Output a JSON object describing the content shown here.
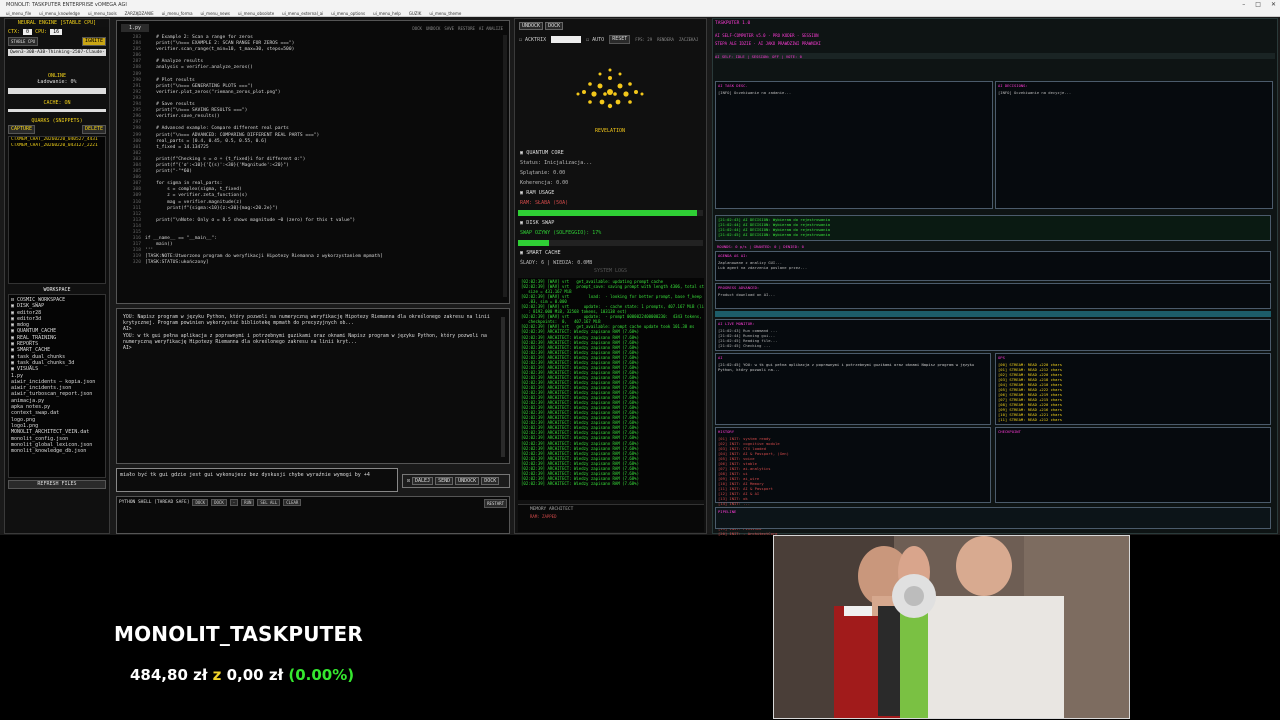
{
  "window": {
    "title": "MONOLIT: TASKPUTER ENTERPRISE vOMEGA AGI",
    "menu": [
      "ui_menu_file",
      "ui_menu_knowledge",
      "ui_menu_tools",
      "ZARZĄDZANIE",
      "ui_menu_forma",
      "ui_menu_news",
      "ui_menu_obsolote",
      "ui_menu_external_ai",
      "ui_menu_options",
      "ui_menu_help",
      "GUZIK",
      "ui_menu_theme"
    ]
  },
  "left": {
    "engine_title": "NEURAL ENGINE [STABLE CPU]",
    "ctx_label": "CTX:",
    "ctx_value": "0",
    "cpu_label": "CPU:",
    "cpu_value": "16",
    "ignite": "IGNITE",
    "mode_label": "STABLE CPU",
    "model": "Qwen3-30B-A3B-Thinking-2507-Claude-",
    "status": "ONLINE",
    "loading": "Ładowanie: 0%",
    "cache": "CACHE: ON",
    "quarks_title": "QUARKS (SNIPPETS)",
    "capture": "CAPTURE",
    "delete": "DELETE",
    "quarks": [
      "CTXMEM_CHAT_20260220_040527_4431",
      "CTXMEM_CHAT_20260220_043127_2221"
    ],
    "workspace_title": "WORKSPACE",
    "tree": [
      "COSMIC_WORKSPACE",
      "DISK_SWAP",
      "editor28",
      "editor3d",
      "mdog",
      "QUANTUM_CACHE",
      "REAL_TRAINING",
      "REPORTS",
      "SMART_CACHE",
      "task_dual_chunks",
      "task_dual_chunks_3d",
      "VISUALS",
      "1.py",
      "aiwir_incidents — kopia.json",
      "aiwir_incidents.json",
      "aiwir_turboscan_report.json",
      "animacja.py",
      "apka notes.py",
      "context_swap.dat",
      "logo.png",
      "logo1.png",
      "MONOLIT_ARCHITECT_VEIN.dat",
      "monolit_config.json",
      "monolit_global_lexicon.json",
      "monolit_knowledge_db.json"
    ],
    "refresh": "REFRESH FILES"
  },
  "editor": {
    "tab": "1.py",
    "toolbar": [
      "DOCK",
      "UNDOCK",
      "SAVE",
      "RESTORE",
      "AI ANALIZE"
    ],
    "first_line": 283,
    "code": [
      "    # Example 2: Scan a range for zeros",
      "    print(\"\\n=== EXAMPLE 2: SCAN RANGE FOR ZEROS ===\")",
      "    verifier.scan_range(t_min=10, t_max=30, steps=500)",
      "",
      "    # Analyze results",
      "    analysis = verifier.analyze_zeros()",
      "",
      "    # Plot results",
      "    print(\"\\n=== GENERATING PLOTS ===\")",
      "    verifier.plot_zeros(\"riemann_zeros_plot.png\")",
      "",
      "    # Save results",
      "    print(\"\\n=== SAVING RESULTS ===\")",
      "    verifier.save_results()",
      "",
      "    # Advanced example: Compare different real parts",
      "    print(\"\\n=== ADVANCED: COMPARING DIFFERENT REAL PARTS ===\")",
      "    real_parts = [0.4, 0.45, 0.5, 0.55, 0.6]",
      "    t_fixed = 14.134725",
      "",
      "    print(f\"Checking s = σ + {t_fixed}i for different σ:\")",
      "    print(f\"{'σ':<10}{'ζ(s)':<30}{'Magnitude':<20}\")",
      "    print(\"-\"*60)",
      "",
      "    for sigma in real_parts:",
      "        s = complex(sigma, t_fixed)",
      "        z = verifier.zeta_function(s)",
      "        mag = verifier.magnitude(z)",
      "        print(f\"{sigma:<10}{z:<30}{mag:<20.2e}\")",
      "",
      "    print(\"\\nNote: Only σ = 0.5 shows magnitude ~0 (zero) for this t value\")",
      "",
      "",
      "if __name__ == \"__main__\":",
      "    main()",
      "'''",
      "[TASK:NOTE:Utworzono program do weryfikacji Hipotezy Riemanna z wykorzystaniem mpmath]",
      "[TASK:STATUS:ukończony]"
    ]
  },
  "chat": {
    "text": "YOU: Napisz program w języku Python, który pozwoli na numeryczną weryfikację Hipotezy Riemanna dla określonego zakresu na linii krytycznej. Program powinien wykorzystać bibliotekę mpmath do precyzyjnych ob...\nAI>\nYOU: w tk gui pełna aplikacja z poprawnymi i potrzebnymi guzikami oraz oknami Napisz program w języku Python, który pozwoli na numeryczną weryfikację Hipotezy Riemanna dla określonego zakresu na linii kryt...\nAI>",
    "input": "miało być tk gui gdzie jest gui wykonujesz bez dyskusji chybe wyraźnie wymogi by\n+4",
    "send": [
      "DALEJ",
      "SEND",
      "UNDOCK",
      "DOCK"
    ],
    "shell_title": "PYTHON SHELL [THREAD SAFE]",
    "shell_buttons": [
      "DOCK",
      "DOCK",
      "-",
      "RUN",
      "SEL ALL",
      "CLEAR"
    ],
    "shell_restart": "RESTART"
  },
  "mid": {
    "top_buttons": [
      "UNDOCK",
      "DOCK"
    ],
    "acktrix": "ACKTRIX",
    "auto": "AUTO",
    "reset": "RESET",
    "fps": "FPS: 29",
    "rendera": "RENDERA",
    "zaczekaj": "ZACZEKAJ",
    "orb_label": "REVELATION",
    "quantum_title": "QUANTUM CORE",
    "status": "Status: Inicjalizacja...",
    "splatanie": "Splątanie: 0.00",
    "koherencja": "Koherencja: 0.00",
    "ram_title": "RAM USAGE",
    "ram_text": "RAM: SŁABA (50A)",
    "ram_fill": 0.97,
    "swap_title": "DISK SWAP",
    "swap_text": "SWAP OZYWY (SOLFEGGIO): 17%",
    "swap_fill": 0.17,
    "smart_title": "SMART CACHE",
    "smart_text": "ŚLADY: 6 | WIEDZA: 0.0MB",
    "syslogs": "SYSTEM LOGS",
    "log_header": [
      "[02:02:39] [WAV] vrt   get_available: updating prompt cache",
      "[02:02:39] [WAV] vrt   prompt_save: saving prompt with length 4306, total state",
      "   size = 431.167 MiB",
      "[02:02:39] [WAV] vrt        load:  - looking for better prompt, base f_keep = 0",
      "   .03, sim = 0.000",
      "[02:02:39] [WAV] vrt      update:  - cache state: 1 prompts, 407.167 MiB (limits",
      "   : 8192.000 MiB, 32568 tokens, 103138 est)",
      "[02:02:39] [WAV] vrt      update:  - prompt 0000022400000230:  4343 tokens,",
      "   checkpoints:  0,   407.167 MiB",
      "[02:02:39] [WAV] vrt   get_available: prompt cache update took 101.38 ms"
    ],
    "log_repeat": "[02:02:39] ARCHITECT: Wiedzy zapisano RAM (7.68%)",
    "log_repeat_count": 31,
    "arch_title": "MEMORY ARCHITECT",
    "arch_text": "RAM: ZAPPED"
  },
  "right": {
    "header": "TASKPUTER 1.0",
    "line1": "AI SELF-COMPUTER v5.0 · PRO KODER · SESSION",
    "line2": "STEPA ALE IDZIE · AI JAKO PRAWDZIWI PRAWNIKI",
    "status_line": "AI SELF: IDLE | SESSION: OFF | VOTE: 0",
    "box_a_title": "AI TASK DESC.",
    "box_a_text": "[INFO] Oczekiwanie na zadanie...",
    "box_b_title": "AI DECISIONS:",
    "box_b_text": "[INFO] Oczekiwanie na decyzje...",
    "decision_lines": [
      "[21:02:43] AI DECISION: Wybieram do rejestrowania",
      "[21:02:44] AI DECISION: Wybieram do rejestrowania",
      "[21:02:44] AI DECISION: Wybieram do rejestrowania",
      "[21:02:45] AI DECISION: Wybieram do rejestrowania"
    ],
    "rounds": "ROUNDS: 0 p/s | GRANTED: 0 | DENIED: 0",
    "agenda": "AGENDA AS AI:",
    "agenda_lines": [
      "Zaplanowane z analizy GUI...",
      "Lub agent na zdarzenia poslane przez..."
    ],
    "progress_title": "PROGRESS ADVANCED:",
    "progress_text": "Product download on AI...",
    "live_title": "AI LIVE MONITOR:",
    "live_lines": [
      "[21:02:43] Run command ...",
      "[21:02:44] Running gui...",
      "[21:02:45] Reading file...",
      "[21:02:45] Checking ..."
    ],
    "chat_title": "AI",
    "chat_text": "[21:02:45] YOU: w tk gui pełna aplikacja z poprawnymi i potrzebnymi guzikami oraz oknami Napisz program w języku Python, który pozwoli na...",
    "ops_title": "OPS",
    "ops_lines": [
      "[00] STREAM: READ +220 chars",
      "[01] STREAM: READ +212 chars",
      "[02] STREAM: READ +220 chars",
      "[03] STREAM: READ +218 chars",
      "[04] STREAM: READ +210 chars",
      "[05] STREAM: READ +222 chars",
      "[06] STREAM: READ +219 chars",
      "[07] STREAM: READ +215 chars",
      "[08] STREAM: READ +220 chars",
      "[09] STREAM: READ +216 chars",
      "[10] STREAM: READ +221 chars",
      "[11] STREAM: READ +212 chars"
    ],
    "hist_title": "HISTORY",
    "hist_lines": [
      "[01] INIT: system ready",
      "[02] INIT: cognitive module",
      "[03] INIT: CTX loaded",
      "[04] INIT: AI & Passport, (Gen)",
      "[05] INIT: voice",
      "[06] INIT: stable",
      "[07] INIT: ai.analytics",
      "[08] INIT: ui",
      "[09] INIT: ai_wire",
      "[10] INIT: AI Memory",
      "[11] INIT: AI & Passport",
      "[12] INIT: AI & AI",
      "[13] INIT: ok",
      "[14] INIT: ...",
      "[15] INIT: ...",
      "[16] INIT: ...",
      "[17] INIT: ...",
      "[18] INIT: ...",
      "[19] INIT: Finished",
      "[20] INIT: - ArchitectCore"
    ],
    "box_empty_title": "CHECKPOINT",
    "bottom_label": "PIPELINE"
  },
  "stream": {
    "title": "MONOLIT_TASKPUTER",
    "price": "484,80 zł",
    "z": "z",
    "change": "0,00 zł",
    "percent": "(0.00%)"
  }
}
